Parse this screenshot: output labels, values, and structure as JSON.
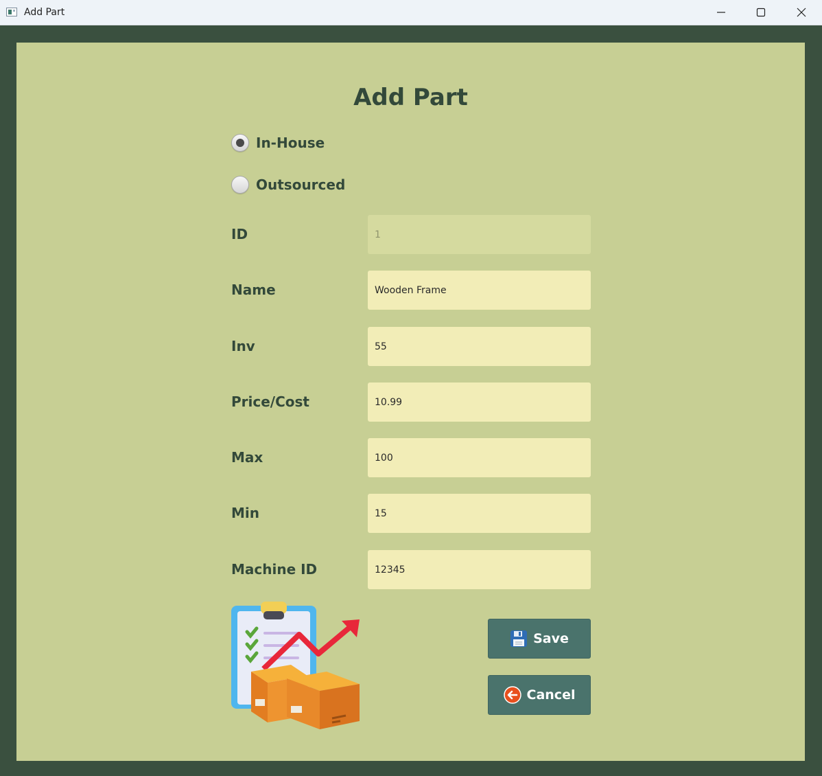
{
  "window": {
    "title": "Add Part"
  },
  "form": {
    "heading": "Add Part",
    "source_options": [
      {
        "label": "In-House",
        "selected": true
      },
      {
        "label": "Outsourced",
        "selected": false
      }
    ],
    "fields": {
      "id": {
        "label": "ID",
        "value": "1",
        "disabled": true
      },
      "name": {
        "label": "Name",
        "value": "Wooden Frame"
      },
      "inv": {
        "label": "Inv",
        "value": "55"
      },
      "price": {
        "label": "Price/Cost",
        "value": "10.99"
      },
      "max": {
        "label": "Max",
        "value": "100"
      },
      "min": {
        "label": "Min",
        "value": "15"
      },
      "machine_id": {
        "label": "Machine ID",
        "value": "12345"
      }
    },
    "buttons": {
      "save": {
        "label": "Save",
        "icon": "floppy-disk-icon"
      },
      "cancel": {
        "label": "Cancel",
        "icon": "back-arrow-icon"
      }
    },
    "illustration": "inventory-clipboard-boxes-illustration"
  },
  "colors": {
    "outer_bg": "#3a503f",
    "panel_bg": "#c7cf94",
    "text": "#33493a",
    "field_bg": "#f2edb7",
    "button_bg": "#4a736c"
  }
}
